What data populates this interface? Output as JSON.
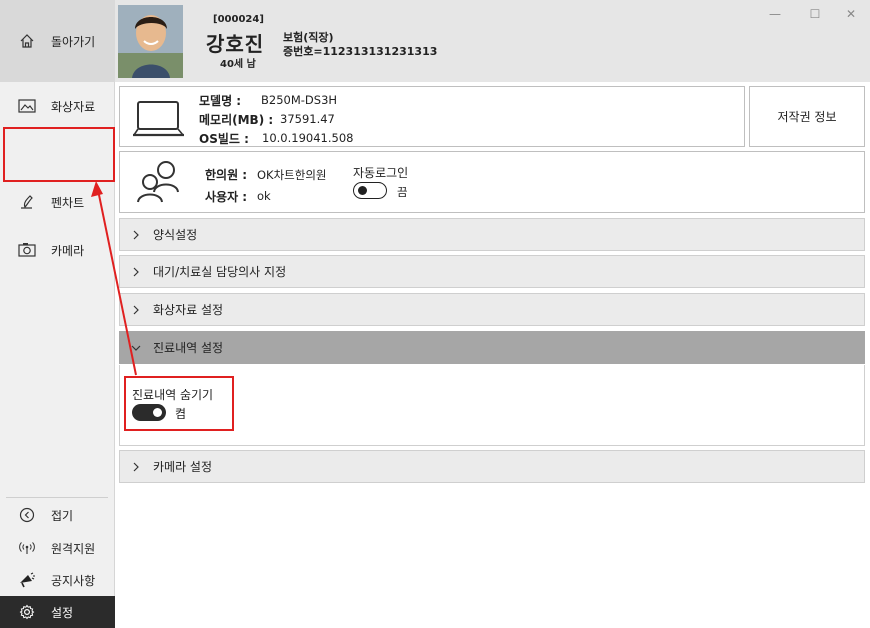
{
  "sidebar": {
    "back_label": "돌아가기",
    "items": [
      {
        "label": "화상자료",
        "icon": "image-icon"
      },
      {
        "label": "펜차트",
        "icon": "pen-icon"
      },
      {
        "label": "카메라",
        "icon": "camera-icon"
      }
    ],
    "bottom_items": [
      {
        "label": "접기",
        "icon": "collapse-icon"
      },
      {
        "label": "원격지원",
        "icon": "remote-icon"
      },
      {
        "label": "공지사항",
        "icon": "megaphone-icon"
      },
      {
        "label": "설정",
        "icon": "gear-icon"
      }
    ]
  },
  "patient": {
    "id": "[000024]",
    "name": "강호진",
    "age_sex": "40세 남",
    "insurance": "보험(직장)",
    "cert": "증번호=112313131231313"
  },
  "window_controls": {
    "minimize": "—",
    "maximize": "☐",
    "close": "✕"
  },
  "system": {
    "model_label": "모델명 :",
    "model_value": "B250M-DS3H",
    "memory_label": "메모리(MB) :",
    "memory_value": "37591.47",
    "os_label": "OS빌드 :",
    "os_value": "10.0.19041.508",
    "copyright_button": "저작권 정보"
  },
  "account": {
    "clinic_label": "한의원 :",
    "clinic_value": "OK차트한의원",
    "user_label": "사용자 :",
    "user_value": "ok",
    "autologin_label": "자동로그인",
    "autologin_state": "끔"
  },
  "sections": [
    {
      "label": "양식설정",
      "expanded": false
    },
    {
      "label": "대기/치료실 담당의사 지정",
      "expanded": false
    },
    {
      "label": "화상자료 설정",
      "expanded": false
    },
    {
      "label": "진료내역 설정",
      "expanded": true
    },
    {
      "label": "카메라 설정",
      "expanded": false
    }
  ],
  "history_setting": {
    "hide_label": "진료내역 숨기기",
    "hide_state": "켬"
  },
  "colors": {
    "sidebar_bg": "#f0f0f0",
    "active_bg": "#2b2b2b",
    "annotation_red": "#e02020",
    "expanded_header": "#a6a6a6"
  }
}
